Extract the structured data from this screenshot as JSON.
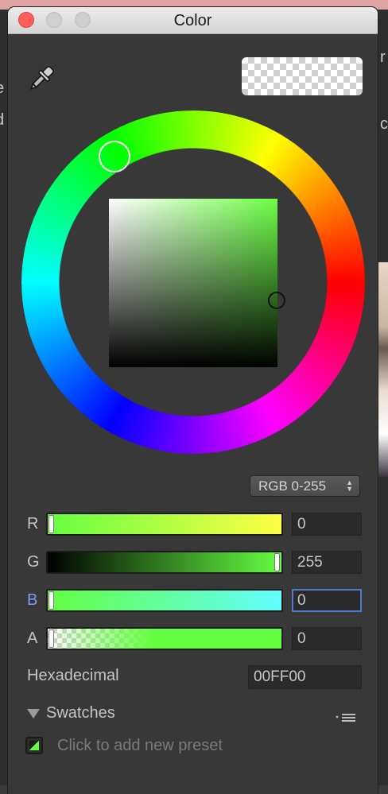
{
  "window": {
    "title": "Color"
  },
  "background_app": {
    "left_chars": [
      "e",
      "d"
    ],
    "right_chars": [
      "r",
      "c"
    ]
  },
  "picker": {
    "eyedropper_icon": "eyedropper-icon",
    "hue_ring_label": "hue wheel",
    "current_color": "#00FF00"
  },
  "mode": {
    "selected": "RGB 0-255",
    "options": [
      "RGB 0-255"
    ]
  },
  "channels": {
    "r": {
      "label": "R",
      "value": "0",
      "fraction": 0.0
    },
    "g": {
      "label": "G",
      "value": "255",
      "fraction": 1.0
    },
    "b": {
      "label": "B",
      "value": "0",
      "fraction": 0.0
    },
    "a": {
      "label": "A",
      "value": "0",
      "fraction": 0.0
    }
  },
  "hex": {
    "label": "Hexadecimal",
    "value": "00FF00"
  },
  "swatches": {
    "label": "Swatches",
    "empty_hint": "Click to add new preset"
  },
  "colors": {
    "window_bg": "#383838",
    "accent_focus": "#4d78d6",
    "close": "#ff5f57"
  }
}
